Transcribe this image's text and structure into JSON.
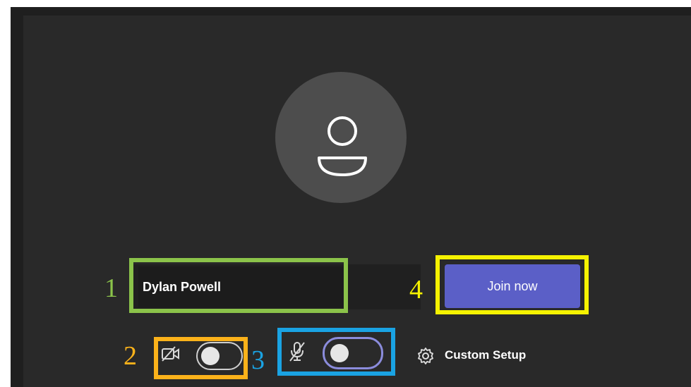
{
  "name_field": {
    "value": "Dylan Powell"
  },
  "join_button": {
    "label": "Join now"
  },
  "camera": {
    "state": "off",
    "icon": "camera-off-icon"
  },
  "microphone": {
    "state": "off",
    "icon": "mic-off-icon"
  },
  "custom_setup": {
    "label": "Custom Setup",
    "icon": "gear-icon"
  },
  "annotations": {
    "one": "1",
    "two": "2",
    "three": "3",
    "four": "4",
    "colors": {
      "one": "#8bc34a",
      "two": "#fbb21a",
      "three": "#1aa3e3",
      "four": "#f5f200"
    }
  },
  "colors": {
    "background": "#292929",
    "accent": "#5b5fc7",
    "avatar": "#4d4d4d"
  }
}
